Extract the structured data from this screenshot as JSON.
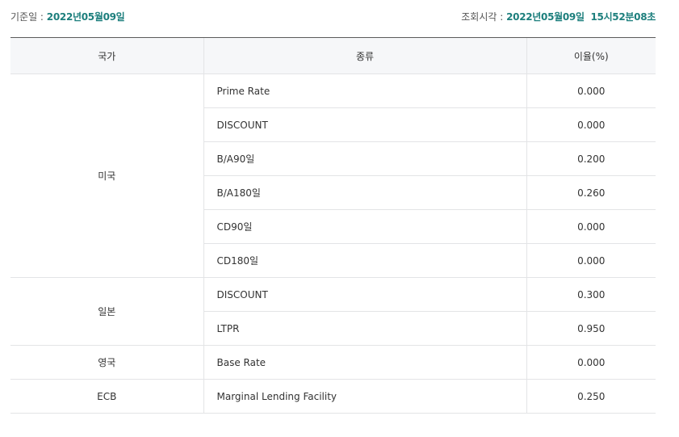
{
  "info": {
    "base_date_label": "기준일 : ",
    "base_date_value": "2022년05월09일",
    "query_time_label": "조회시각 : ",
    "query_time_value": "2022년05월09일  15시52분08초"
  },
  "table": {
    "headers": {
      "country": "국가",
      "type": "종류",
      "rate": "이율(%)"
    },
    "groups": [
      {
        "country": "미국",
        "rows": [
          {
            "type": "Prime Rate",
            "rate": "0.000"
          },
          {
            "type": "DISCOUNT",
            "rate": "0.000"
          },
          {
            "type": "B/A90일",
            "rate": "0.200"
          },
          {
            "type": "B/A180일",
            "rate": "0.260"
          },
          {
            "type": "CD90일",
            "rate": "0.000"
          },
          {
            "type": "CD180일",
            "rate": "0.000"
          }
        ]
      },
      {
        "country": "일본",
        "rows": [
          {
            "type": "DISCOUNT",
            "rate": "0.300"
          },
          {
            "type": "LTPR",
            "rate": "0.950"
          }
        ]
      },
      {
        "country": "영국",
        "rows": [
          {
            "type": "Base Rate",
            "rate": "0.000"
          }
        ]
      },
      {
        "country": "ECB",
        "rows": [
          {
            "type": "Marginal Lending Facility",
            "rate": "0.250"
          }
        ]
      }
    ]
  }
}
